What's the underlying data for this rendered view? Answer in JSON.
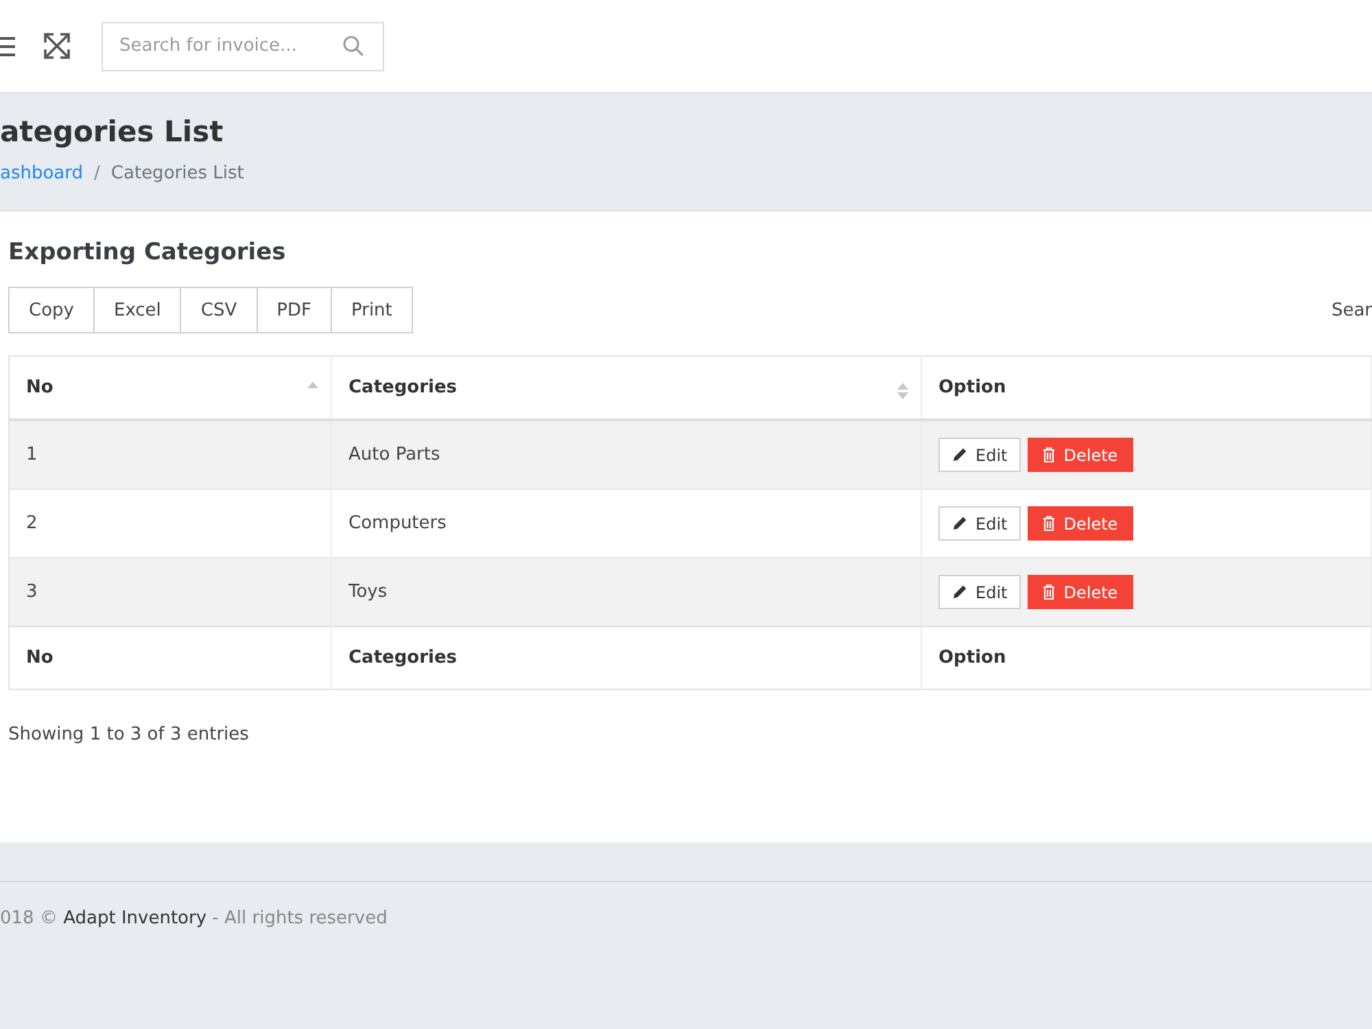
{
  "topbar": {
    "search": {
      "placeholder": "Search for invoice..."
    }
  },
  "page_header": {
    "title": "ategories List",
    "breadcrumb": {
      "separator": "/",
      "items": [
        {
          "label": "ashboard",
          "kind": "link"
        },
        {
          "label": "Categories List",
          "kind": "current"
        }
      ]
    }
  },
  "card": {
    "title": "Exporting Categories",
    "export_buttons": [
      "Copy",
      "Excel",
      "CSV",
      "PDF",
      "Print"
    ],
    "search_label": "Sear",
    "table": {
      "columns": [
        {
          "label": "No",
          "sortable": true,
          "sorted": true
        },
        {
          "label": "Categories",
          "sortable": true,
          "sorted": false
        },
        {
          "label": "Option",
          "sortable": false
        }
      ],
      "rows": [
        {
          "no": "1",
          "category": "Auto Parts",
          "actions": [
            {
              "kind": "edit",
              "label": "Edit"
            },
            {
              "kind": "delete",
              "label": "Delete"
            }
          ]
        },
        {
          "no": "2",
          "category": "Computers",
          "actions": [
            {
              "kind": "edit",
              "label": "Edit"
            },
            {
              "kind": "delete",
              "label": "Delete"
            }
          ]
        },
        {
          "no": "3",
          "category": "Toys",
          "actions": [
            {
              "kind": "edit",
              "label": "Edit"
            },
            {
              "kind": "delete",
              "label": "Delete"
            }
          ]
        }
      ],
      "footer": [
        "No",
        "Categories",
        "Option"
      ]
    },
    "info": "Showing 1 to 3 of 3 entries"
  },
  "footer": {
    "prefix": "018 ©",
    "link": "Adapt Inventory",
    "suffix": "- All rights reserved"
  }
}
